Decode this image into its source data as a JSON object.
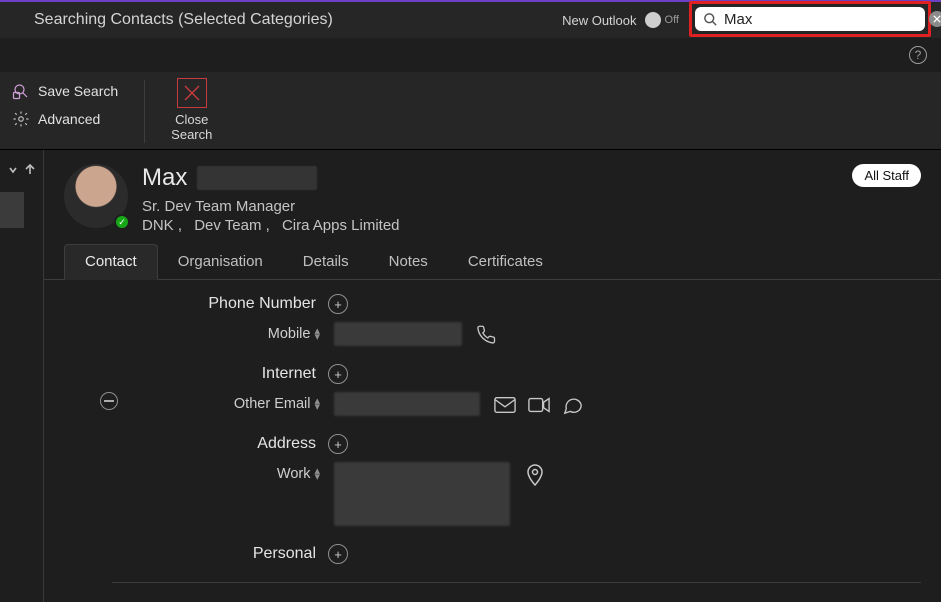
{
  "topbar": {
    "title": "Searching Contacts (Selected Categories)",
    "new_outlook_label": "New Outlook",
    "new_outlook_state": "Off",
    "search_value": "Max"
  },
  "ribbon": {
    "save_search": "Save Search",
    "advanced": "Advanced",
    "close_l1": "Close",
    "close_l2": "Search"
  },
  "contact": {
    "first_name": "Max",
    "job_title": "Sr. Dev Team Manager",
    "org_parts": [
      "DNK ,",
      "Dev Team ,",
      "Cira Apps Limited"
    ],
    "badge": "All Staff"
  },
  "tabs": [
    "Contact",
    "Organisation",
    "Details",
    "Notes",
    "Certificates"
  ],
  "active_tab_index": 0,
  "sections": {
    "phone": {
      "title": "Phone Number",
      "label": "Mobile"
    },
    "internet": {
      "title": "Internet",
      "label": "Other Email"
    },
    "address": {
      "title": "Address",
      "label": "Work"
    },
    "personal": {
      "title": "Personal"
    }
  }
}
